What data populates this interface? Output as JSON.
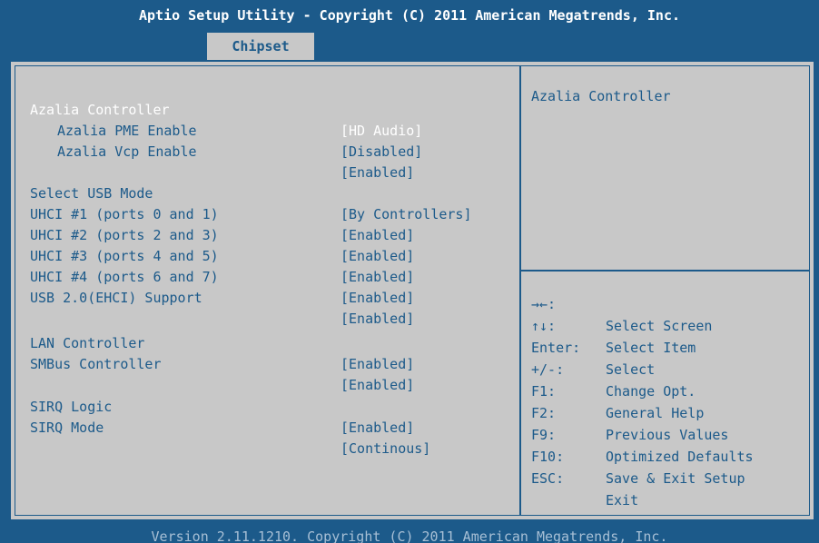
{
  "header": {
    "title": "Aptio Setup Utility - Copyright (C) 2011 American Megatrends, Inc.",
    "tab": "Chipset"
  },
  "settings": [
    {
      "label": "Azalia Controller",
      "value": "[HD Audio]",
      "indent": false,
      "selected": true
    },
    {
      "label": "Azalia PME Enable",
      "value": "[Disabled]",
      "indent": true
    },
    {
      "label": "Azalia Vcp Enable",
      "value": "[Enabled]",
      "indent": true
    },
    {
      "label": "Select USB Mode",
      "value": "[By Controllers]",
      "indent": false
    },
    {
      "label": "UHCI #1 (ports 0 and 1)",
      "value": "[Enabled]",
      "indent": false
    },
    {
      "label": "UHCI #2 (ports 2 and 3)",
      "value": "[Enabled]",
      "indent": false
    },
    {
      "label": "UHCI #3 (ports 4 and 5)",
      "value": "[Enabled]",
      "indent": false
    },
    {
      "label": "UHCI #4 (ports 6 and 7)",
      "value": "[Enabled]",
      "indent": false
    },
    {
      "label": "USB 2.0(EHCI) Support",
      "value": "[Enabled]",
      "indent": false
    },
    {
      "label": "LAN Controller",
      "value": "[Enabled]",
      "indent": false
    },
    {
      "label": "SMBus Controller",
      "value": "[Enabled]",
      "indent": false
    },
    {
      "label": "SIRQ Logic",
      "value": "[Enabled]",
      "indent": false
    },
    {
      "label": "SIRQ Mode",
      "value": "[Continous]",
      "indent": false
    }
  ],
  "help": {
    "title": "Azalia Controller"
  },
  "keys": [
    {
      "key": "→←:",
      "desc": "Select Screen"
    },
    {
      "key": "↑↓:",
      "desc": "Select Item"
    },
    {
      "key": "Enter:",
      "desc": "Select"
    },
    {
      "key": "+/-:",
      "desc": "Change Opt."
    },
    {
      "key": "F1:",
      "desc": "General Help"
    },
    {
      "key": "F2:",
      "desc": "Previous Values"
    },
    {
      "key": "F9:",
      "desc": "Optimized Defaults"
    },
    {
      "key": "F10:",
      "desc": "Save & Exit Setup"
    },
    {
      "key": "ESC:",
      "desc": "Exit"
    }
  ],
  "footer": {
    "text": "Version 2.11.1210. Copyright (C) 2011 American Megatrends, Inc."
  },
  "colors": {
    "frame": "#1c5a8a",
    "panel": "#c8c8c8",
    "selected_text": "#ffffff"
  }
}
